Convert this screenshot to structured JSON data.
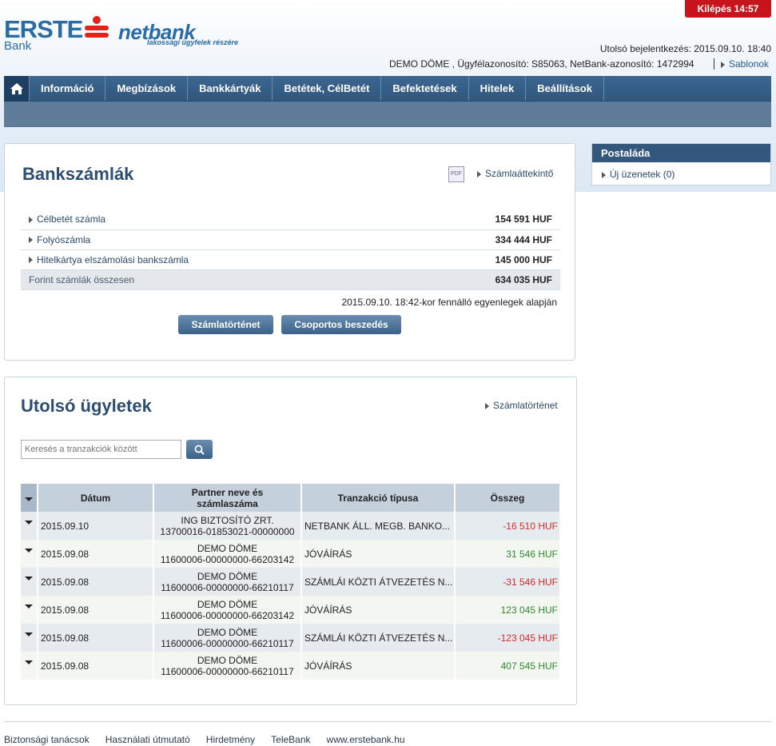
{
  "header": {
    "logout": "Kilépés 14:57",
    "logo_erste": "ERSTE",
    "logo_bank": "Bank",
    "logo_netbank": "netbank",
    "logo_tagline": "lakossági ügyfelek részére",
    "last_login": "Utolsó bejelentkezés: 2015.09.10. 18:40",
    "user_info": "DEMO DÖME , Ügyfélazonosító: S85063, NetBank-azonosító: 1472994",
    "templates_link": "Sablonok"
  },
  "nav": {
    "items": [
      "Információ",
      "Megbízások",
      "Bankkártyák",
      "Betétek, CélBetét",
      "Befektetések",
      "Hitelek",
      "Beállítások"
    ]
  },
  "accounts": {
    "title": "Bankszámlák",
    "pdf_label": "PDF",
    "overview_link": "Számlaáttekintő",
    "rows": [
      {
        "name": "Célbetét számla",
        "amount": "154 591 HUF"
      },
      {
        "name": "Folyószámla",
        "amount": "334 444 HUF"
      },
      {
        "name": "Hitelkártya elszámolási bankszámla",
        "amount": "145 000 HUF"
      }
    ],
    "total_label": "Forint számlák összesen",
    "total_amount": "634 035 HUF",
    "note": "2015.09.10. 18:42-kor fennálló egyenlegek alapján",
    "history_button": "Számlatörténet",
    "group_button": "Csoportos beszedés"
  },
  "transactions": {
    "title": "Utolsó ügyletek",
    "history_link": "Számlatörténet",
    "search_placeholder": "Keresés a tranzakciók között",
    "columns": [
      "Dátum",
      "Partner neve és számlaszáma",
      "Tranzakció típusa",
      "Összeg"
    ],
    "rows": [
      {
        "date": "2015.09.10",
        "partner_name": "ING BIZTOSÍTÓ ZRT.",
        "partner_account": "13700016-01853021-00000000",
        "type": "NETBANK ÁLL. MEGB. BANKO...",
        "amount": "-16 510 HUF",
        "sign": "neg"
      },
      {
        "date": "2015.09.08",
        "partner_name": "DEMO DÖME",
        "partner_account": "11600006-00000000-66203142",
        "type": "JÓVÁÍRÁS",
        "amount": "31 546 HUF",
        "sign": "pos"
      },
      {
        "date": "2015.09.08",
        "partner_name": "DEMO DÖME",
        "partner_account": "11600006-00000000-66210117",
        "type": "SZÁMLÁI KÖZTI ÁTVEZETÉS N...",
        "amount": "-31 546 HUF",
        "sign": "neg"
      },
      {
        "date": "2015.09.08",
        "partner_name": "DEMO DÖME",
        "partner_account": "11600006-00000000-66203142",
        "type": "JÓVÁÍRÁS",
        "amount": "123 045 HUF",
        "sign": "pos"
      },
      {
        "date": "2015.09.08",
        "partner_name": "DEMO DÖME",
        "partner_account": "11600006-00000000-66210117",
        "type": "SZÁMLÁI KÖZTI ÁTVEZETÉS N...",
        "amount": "-123 045 HUF",
        "sign": "neg"
      },
      {
        "date": "2015.09.08",
        "partner_name": "DEMO DÖME",
        "partner_account": "11600006-00000000-66210117",
        "type": "JÓVÁÍRÁS",
        "amount": "407 545 HUF",
        "sign": "pos"
      }
    ]
  },
  "mailbox": {
    "title": "Postaláda",
    "new_messages": "Új üzenetek (0)"
  },
  "footer": {
    "links": [
      "Biztonsági tanácsok",
      "Használati útmutató",
      "Hirdetmény",
      "TeleBank",
      "www.erstebank.hu"
    ]
  },
  "colors": {
    "brand_blue": "#2a6ca6",
    "nav_dark": "#2f5780",
    "logout_red": "#c8141c",
    "negative": "#d42a2a",
    "positive": "#2f8a2f"
  },
  "icons": {
    "home": "home-icon",
    "search": "search-icon",
    "pdf": "pdf-icon",
    "arrow": "arrow-right-icon",
    "toggle": "caret-down-icon"
  }
}
